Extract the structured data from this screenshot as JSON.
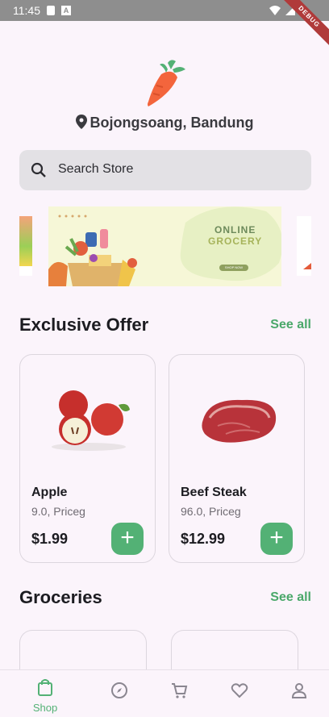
{
  "status_bar": {
    "time": "11:45",
    "debug_label": "DEBUG"
  },
  "header": {
    "location": "Bojongsoang, Bandung"
  },
  "search": {
    "placeholder": "Search Store"
  },
  "banner": {
    "title_line1": "ONLINE",
    "title_line2": "GROCERY",
    "button": "SHOP NOW"
  },
  "sections": {
    "exclusive": {
      "title": "Exclusive Offer",
      "see_all": "See all",
      "items": [
        {
          "name": "Apple",
          "subtitle": "9.0, Priceg",
          "price": "$1.99"
        },
        {
          "name": "Beef Steak",
          "subtitle": "96.0, Priceg",
          "price": "$12.99"
        }
      ]
    },
    "groceries": {
      "title": "Groceries",
      "see_all": "See all"
    }
  },
  "nav": {
    "shop": "Shop"
  },
  "colors": {
    "accent": "#53b175",
    "background": "#fbf4fb",
    "search_bg": "#e3e1e5"
  }
}
